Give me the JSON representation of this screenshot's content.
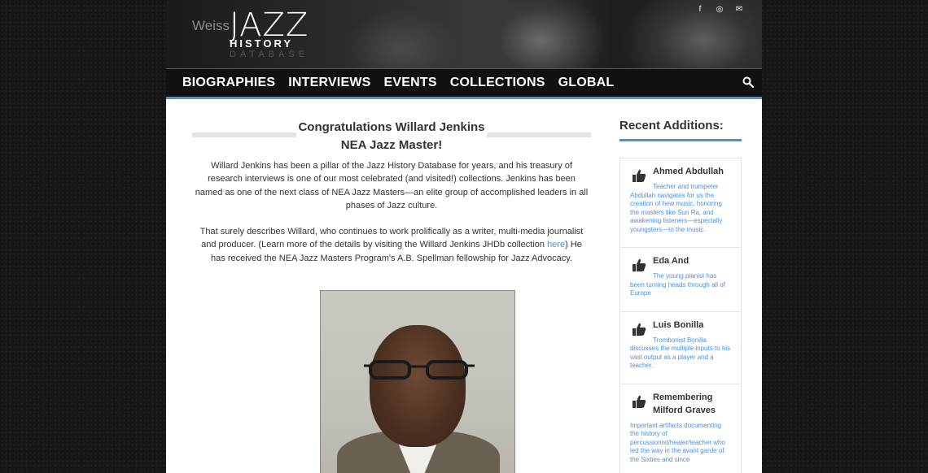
{
  "brand": {
    "weiss": "Weiss",
    "jazz": "JAZZ",
    "history": "HISTORY",
    "database": "DATABASE"
  },
  "social": [
    {
      "icon": "facebook-icon",
      "glyph": "f"
    },
    {
      "icon": "instagram-icon",
      "glyph": "◎"
    },
    {
      "icon": "email-icon",
      "glyph": "✉"
    }
  ],
  "nav": {
    "items": [
      "BIOGRAPHIES",
      "INTERVIEWS",
      "EVENTS",
      "COLLECTIONS",
      "GLOBAL"
    ],
    "search_icon": "search-icon"
  },
  "article": {
    "title_line1": "Congratulations Willard Jenkins",
    "title_line2": "NEA Jazz Master!",
    "paragraph1": "Willard Jenkins has been a pillar of the Jazz History Database for years, and his treasury of research interviews is one of our most celebrated (and visited!) collections. Jenkins has been named as one of the next class of NEA Jazz Masters—an elite group of accomplished leaders in all phases of Jazz culture.",
    "paragraph2_before": "That surely describes Willard, who continues to work prolifically as a writer, multi-media journalist and producer. (Learn more of the details by visiting the Willard Jenkins JHDb collection ",
    "paragraph2_link": "here",
    "paragraph2_after": ") He has received the NEA Jazz Masters Program's A.B. Spellman fellowship for Jazz Advocacy."
  },
  "sidebar": {
    "heading": "Recent Additions:",
    "items": [
      {
        "name": "Ahmed Abdullah",
        "desc": "Teacher and trumpeter Abdullah navigates for us the creation of hew music, honoring the masters like Sun Ra, and awakening listeners—especially youngsters—to the music."
      },
      {
        "name": "Eda And",
        "desc": "The young pianist has been turning heads through all of Europe"
      },
      {
        "name": "Luis Bonilla",
        "desc": "Trombonist Bonilla discusses the multiple inputs to his vast output as a player and a teacher."
      },
      {
        "name": "Remembering Milford Graves",
        "desc": "Important artifacts documenting the history of percussionist/healer/teacher who led the way in the avant garde of the Sixties and since"
      }
    ]
  },
  "colors": {
    "accent": "#4a90e2",
    "text": "#333333",
    "nav_bg": "#111111"
  }
}
